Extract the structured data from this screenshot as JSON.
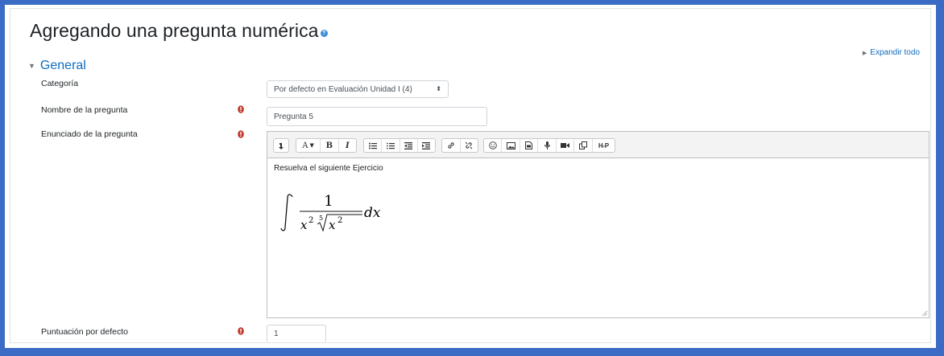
{
  "page": {
    "title": "Agregando una pregunta numérica"
  },
  "expand_all": {
    "label": "Expandir todo"
  },
  "section": {
    "title": "General"
  },
  "fields": {
    "category": {
      "label": "Categoría",
      "value": "Por defecto en Evaluación Unidad I (4)"
    },
    "name": {
      "label": "Nombre de la pregunta",
      "value": "Pregunta 5"
    },
    "text": {
      "label": "Enunciado de la pregunta",
      "content_line": "Resuelva el siguiente Ejercicio"
    },
    "score": {
      "label": "Puntuación por defecto",
      "value": "1"
    }
  },
  "toolbar": {
    "buttons": [
      "collapse-icon",
      "font-style-icon",
      "bold-icon",
      "italic-icon",
      "unordered-list-icon",
      "ordered-list-icon",
      "outdent-icon",
      "indent-icon",
      "link-icon",
      "unlink-icon",
      "emoticon-icon",
      "image-icon",
      "media-icon",
      "record-audio-icon",
      "record-video-icon",
      "manage-files-icon",
      "h5p-icon"
    ],
    "font_label": "A",
    "h5p_label": "H-P"
  },
  "math": {
    "numerator": "1",
    "base": "x",
    "exp": "2",
    "root_index": "5",
    "differential": "dx"
  },
  "colors": {
    "accent": "#0f6cbf",
    "required": "#c0392b",
    "frame": "#3b6bc4"
  }
}
